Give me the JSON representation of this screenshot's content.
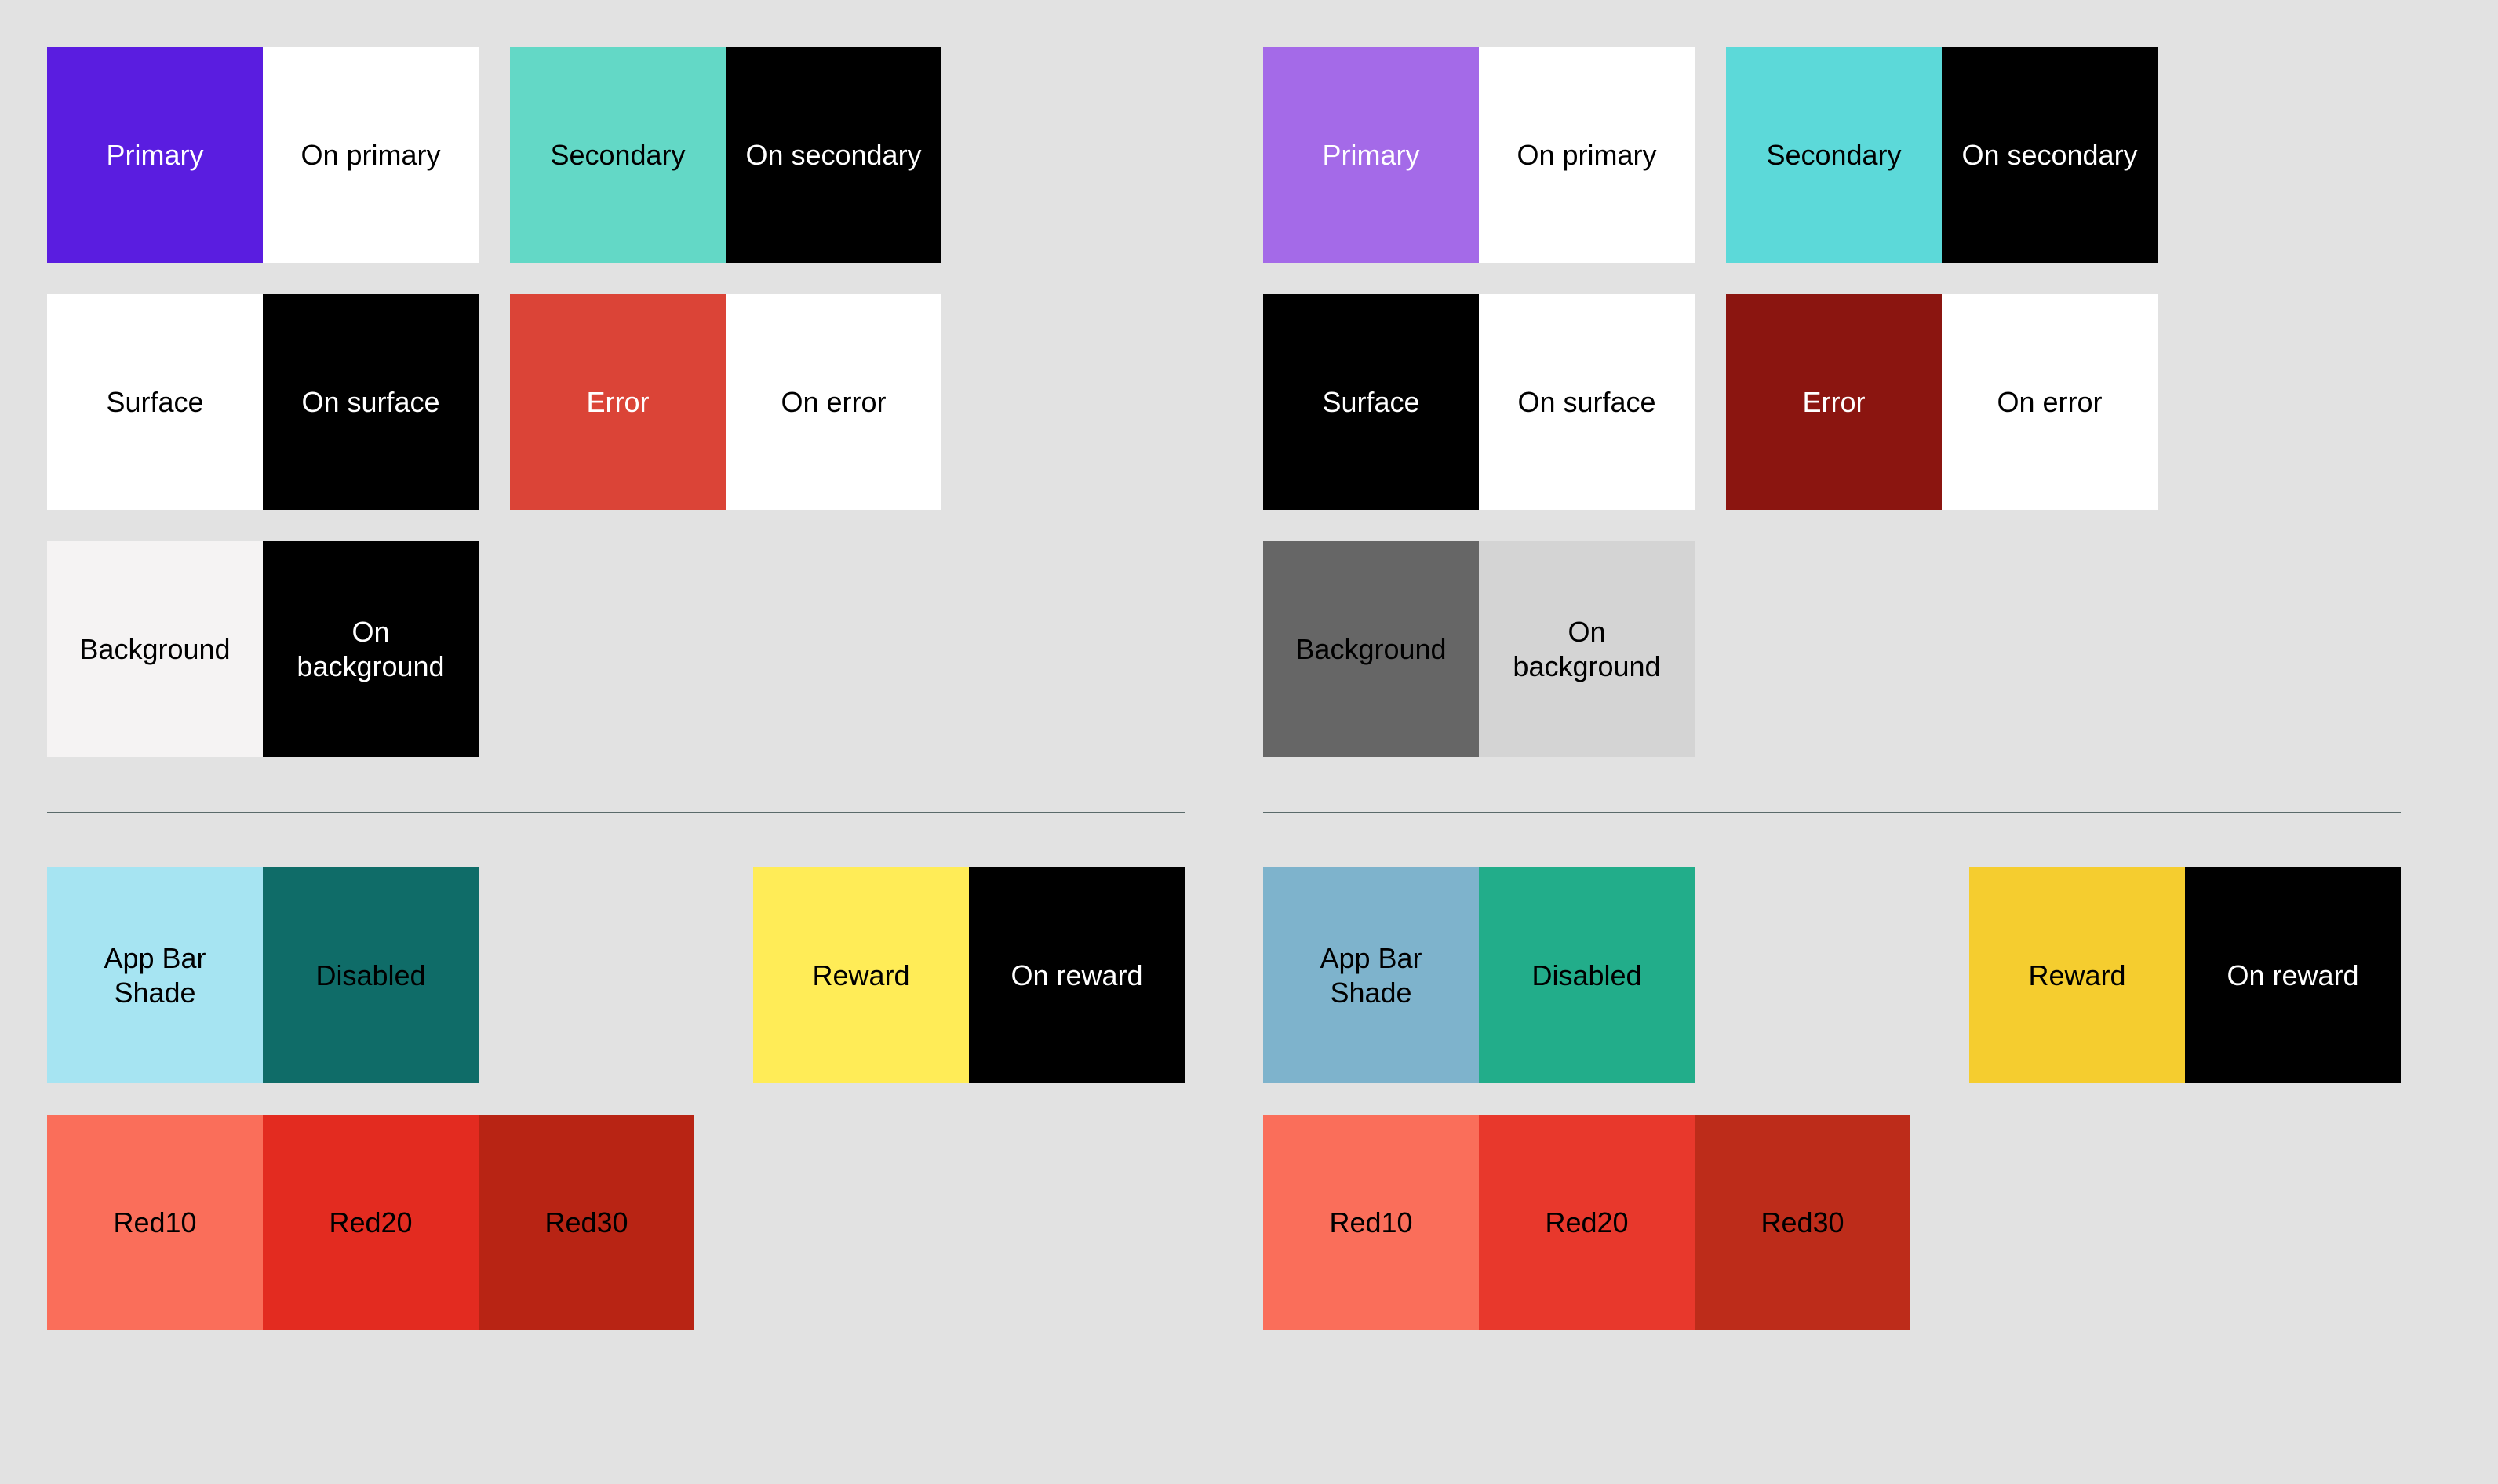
{
  "labels": {
    "primary": "Primary",
    "on_primary": "On primary",
    "secondary": "Secondary",
    "on_secondary": "On secondary",
    "surface": "Surface",
    "on_surface": "On surface",
    "error_": "Error",
    "on_error": "On error",
    "background": "Background",
    "on_background": "On background",
    "app_bar_shade": "App Bar Shade",
    "disabled": "Disabled",
    "reward": "Reward",
    "on_reward": "On reward",
    "red10": "Red10",
    "red20": "Red20",
    "red30": "Red30"
  },
  "palettes": {
    "left": {
      "primary": {
        "bg": "#5a1de0",
        "fg": "#ffffff"
      },
      "on_primary": {
        "bg": "#ffffff",
        "fg": "#000000"
      },
      "secondary": {
        "bg": "#63d8c6",
        "fg": "#000000"
      },
      "on_secondary": {
        "bg": "#000000",
        "fg": "#ffffff"
      },
      "surface": {
        "bg": "#ffffff",
        "fg": "#000000"
      },
      "on_surface": {
        "bg": "#000000",
        "fg": "#ffffff"
      },
      "error_": {
        "bg": "#db4437",
        "fg": "#ffffff"
      },
      "on_error": {
        "bg": "#ffffff",
        "fg": "#000000"
      },
      "background": {
        "bg": "#f5f3f3",
        "fg": "#000000"
      },
      "on_background": {
        "bg": "#000000",
        "fg": "#ffffff"
      },
      "app_bar_shade": {
        "bg": "#a6e4f2",
        "fg": "#000000"
      },
      "disabled": {
        "bg": "#0f6c68",
        "fg": "#000000"
      },
      "reward": {
        "bg": "#ffec57",
        "fg": "#000000"
      },
      "on_reward": {
        "bg": "#000000",
        "fg": "#ffffff"
      },
      "red10": {
        "bg": "#fa6e5a",
        "fg": "#000000"
      },
      "red20": {
        "bg": "#e32b20",
        "fg": "#000000"
      },
      "red30": {
        "bg": "#b82414",
        "fg": "#000000"
      }
    },
    "right": {
      "primary": {
        "bg": "#a46ae8",
        "fg": "#ffffff"
      },
      "on_primary": {
        "bg": "#ffffff",
        "fg": "#000000"
      },
      "secondary": {
        "bg": "#5cd9d9",
        "fg": "#000000"
      },
      "on_secondary": {
        "bg": "#000000",
        "fg": "#ffffff"
      },
      "surface": {
        "bg": "#000000",
        "fg": "#ffffff"
      },
      "on_surface": {
        "bg": "#ffffff",
        "fg": "#000000"
      },
      "error_": {
        "bg": "#8b1510",
        "fg": "#ffffff"
      },
      "on_error": {
        "bg": "#ffffff",
        "fg": "#000000"
      },
      "background": {
        "bg": "#666666",
        "fg": "#000000"
      },
      "on_background": {
        "bg": "#d4d4d4",
        "fg": "#000000"
      },
      "app_bar_shade": {
        "bg": "#7eb3cc",
        "fg": "#000000"
      },
      "disabled": {
        "bg": "#22ad8a",
        "fg": "#000000"
      },
      "reward": {
        "bg": "#f5cd2f",
        "fg": "#000000"
      },
      "on_reward": {
        "bg": "#000000",
        "fg": "#ffffff"
      },
      "red10": {
        "bg": "#fa6e5a",
        "fg": "#000000"
      },
      "red20": {
        "bg": "#e8382c",
        "fg": "#000000"
      },
      "red30": {
        "bg": "#bd2c1a",
        "fg": "#000000"
      }
    }
  }
}
